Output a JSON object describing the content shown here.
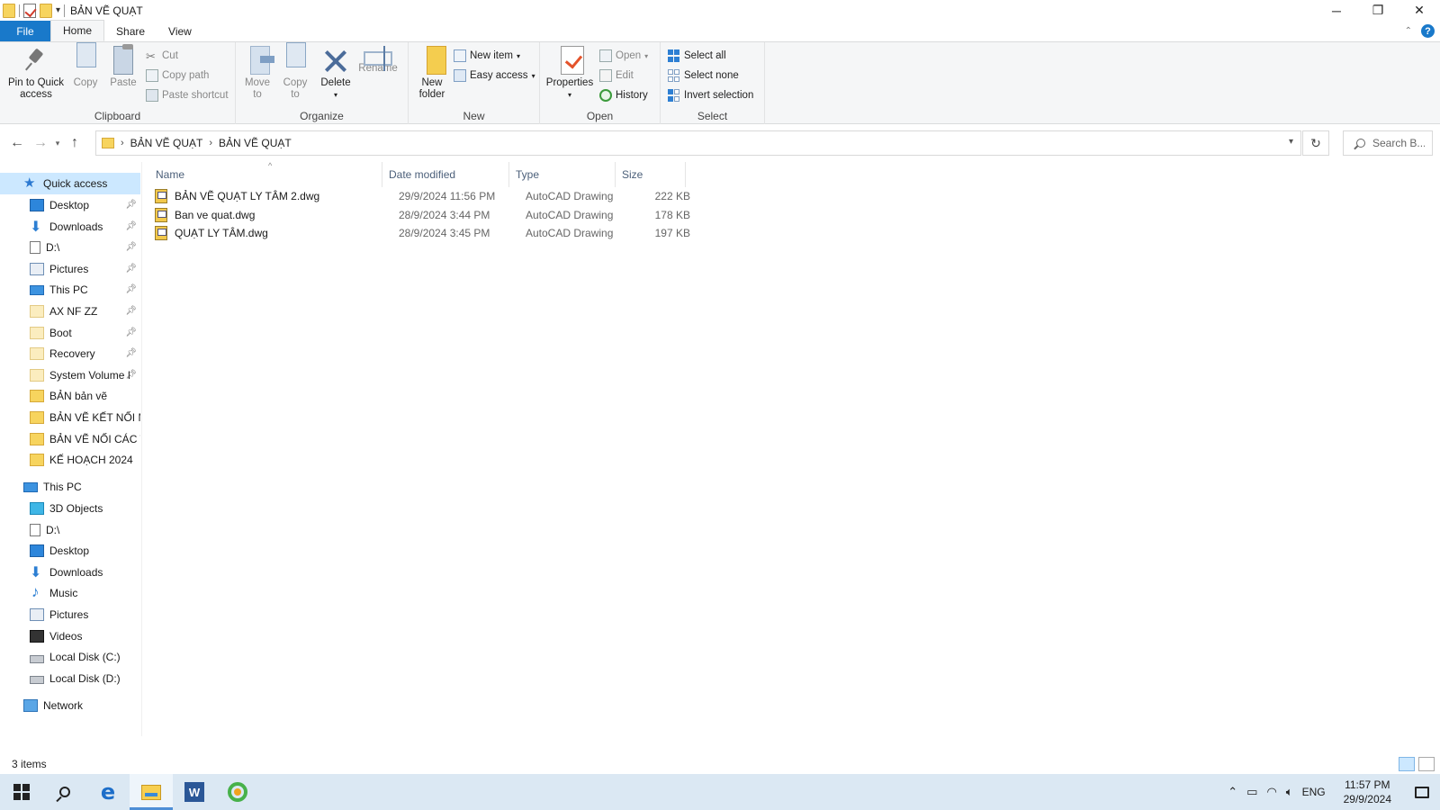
{
  "window": {
    "title": "BẢN VẼ QUẠT",
    "minimize_glyph": "─",
    "restore_glyph": "❐",
    "close_glyph": "✕"
  },
  "ribbon_tabs": [
    "File",
    "Home",
    "Share",
    "View"
  ],
  "ribbon": {
    "clipboard": {
      "label": "Clipboard",
      "pin_label_1": "Pin to Quick",
      "pin_label_2": "access",
      "copy": "Copy",
      "paste": "Paste",
      "cut": "Cut",
      "copy_path": "Copy path",
      "paste_shortcut": "Paste shortcut"
    },
    "organize": {
      "label": "Organize",
      "move_1": "Move",
      "move_2": "to",
      "copy_1": "Copy",
      "copy_2": "to",
      "delete": "Delete",
      "rename": "Rename"
    },
    "new": {
      "label": "New",
      "new_folder_1": "New",
      "new_folder_2": "folder",
      "new_item": "New item",
      "easy_access": "Easy access"
    },
    "open": {
      "label": "Open",
      "properties": "Properties",
      "open": "Open",
      "edit": "Edit",
      "history": "History"
    },
    "select": {
      "label": "Select",
      "select_all": "Select all",
      "select_none": "Select none",
      "invert_selection": "Invert selection"
    }
  },
  "address": {
    "crumbs": [
      "BẢN VẼ QUẠT",
      "BẢN VẼ QUẠT"
    ],
    "search_placeholder": "Search B..."
  },
  "nav": {
    "quick_access": "Quick access",
    "quick_items": [
      {
        "label": "Desktop",
        "icon": "desktop-icon"
      },
      {
        "label": "Downloads",
        "icon": "downloads-icon"
      },
      {
        "label": "D:\\",
        "icon": "drive-icon"
      },
      {
        "label": "Pictures",
        "icon": "pictures-icon"
      },
      {
        "label": "This PC",
        "icon": "pc-icon"
      },
      {
        "label": "AX NF ZZ",
        "icon": "folder-icon"
      },
      {
        "label": "Boot",
        "icon": "folder-icon"
      },
      {
        "label": "Recovery",
        "icon": "folder-icon"
      },
      {
        "label": "System Volume I",
        "icon": "folder-icon"
      },
      {
        "label": "BẢN bản vẽ",
        "icon": "folder-icon"
      },
      {
        "label": "BẢN VẼ KẾT NỐI M(",
        "icon": "folder-icon"
      },
      {
        "label": "BẢN VẼ NỐI CÁC TI",
        "icon": "folder-icon"
      },
      {
        "label": "KẾ HOẠCH 2024",
        "icon": "folder-icon"
      }
    ],
    "this_pc": "This PC",
    "pc_items": [
      {
        "label": "3D Objects",
        "icon": "3d-objects-icon"
      },
      {
        "label": "D:\\",
        "icon": "drive-icon"
      },
      {
        "label": "Desktop",
        "icon": "desktop-icon"
      },
      {
        "label": "Downloads",
        "icon": "downloads-icon"
      },
      {
        "label": "Music",
        "icon": "music-icon"
      },
      {
        "label": "Pictures",
        "icon": "pictures-icon"
      },
      {
        "label": "Videos",
        "icon": "videos-icon"
      },
      {
        "label": "Local Disk (C:)",
        "icon": "disk-icon"
      },
      {
        "label": "Local Disk (D:)",
        "icon": "disk-icon"
      }
    ],
    "network": "Network"
  },
  "columns": {
    "name": "Name",
    "date": "Date modified",
    "type": "Type",
    "size": "Size"
  },
  "files": [
    {
      "name": "BẢN VẼ QUẠT LY TÂM 2.dwg",
      "date": "29/9/2024 11:56 PM",
      "type": "AutoCAD Drawing",
      "size": "222 KB"
    },
    {
      "name": "Ban ve quat.dwg",
      "date": "28/9/2024 3:44 PM",
      "type": "AutoCAD Drawing",
      "size": "178 KB"
    },
    {
      "name": "QUẠT LY TÂM.dwg",
      "date": "28/9/2024 3:45 PM",
      "type": "AutoCAD Drawing",
      "size": "197 KB"
    }
  ],
  "status": {
    "items_count": "3 items"
  },
  "taskbar": {
    "lang": "ENG",
    "time": "11:57 PM",
    "date": "29/9/2024"
  }
}
